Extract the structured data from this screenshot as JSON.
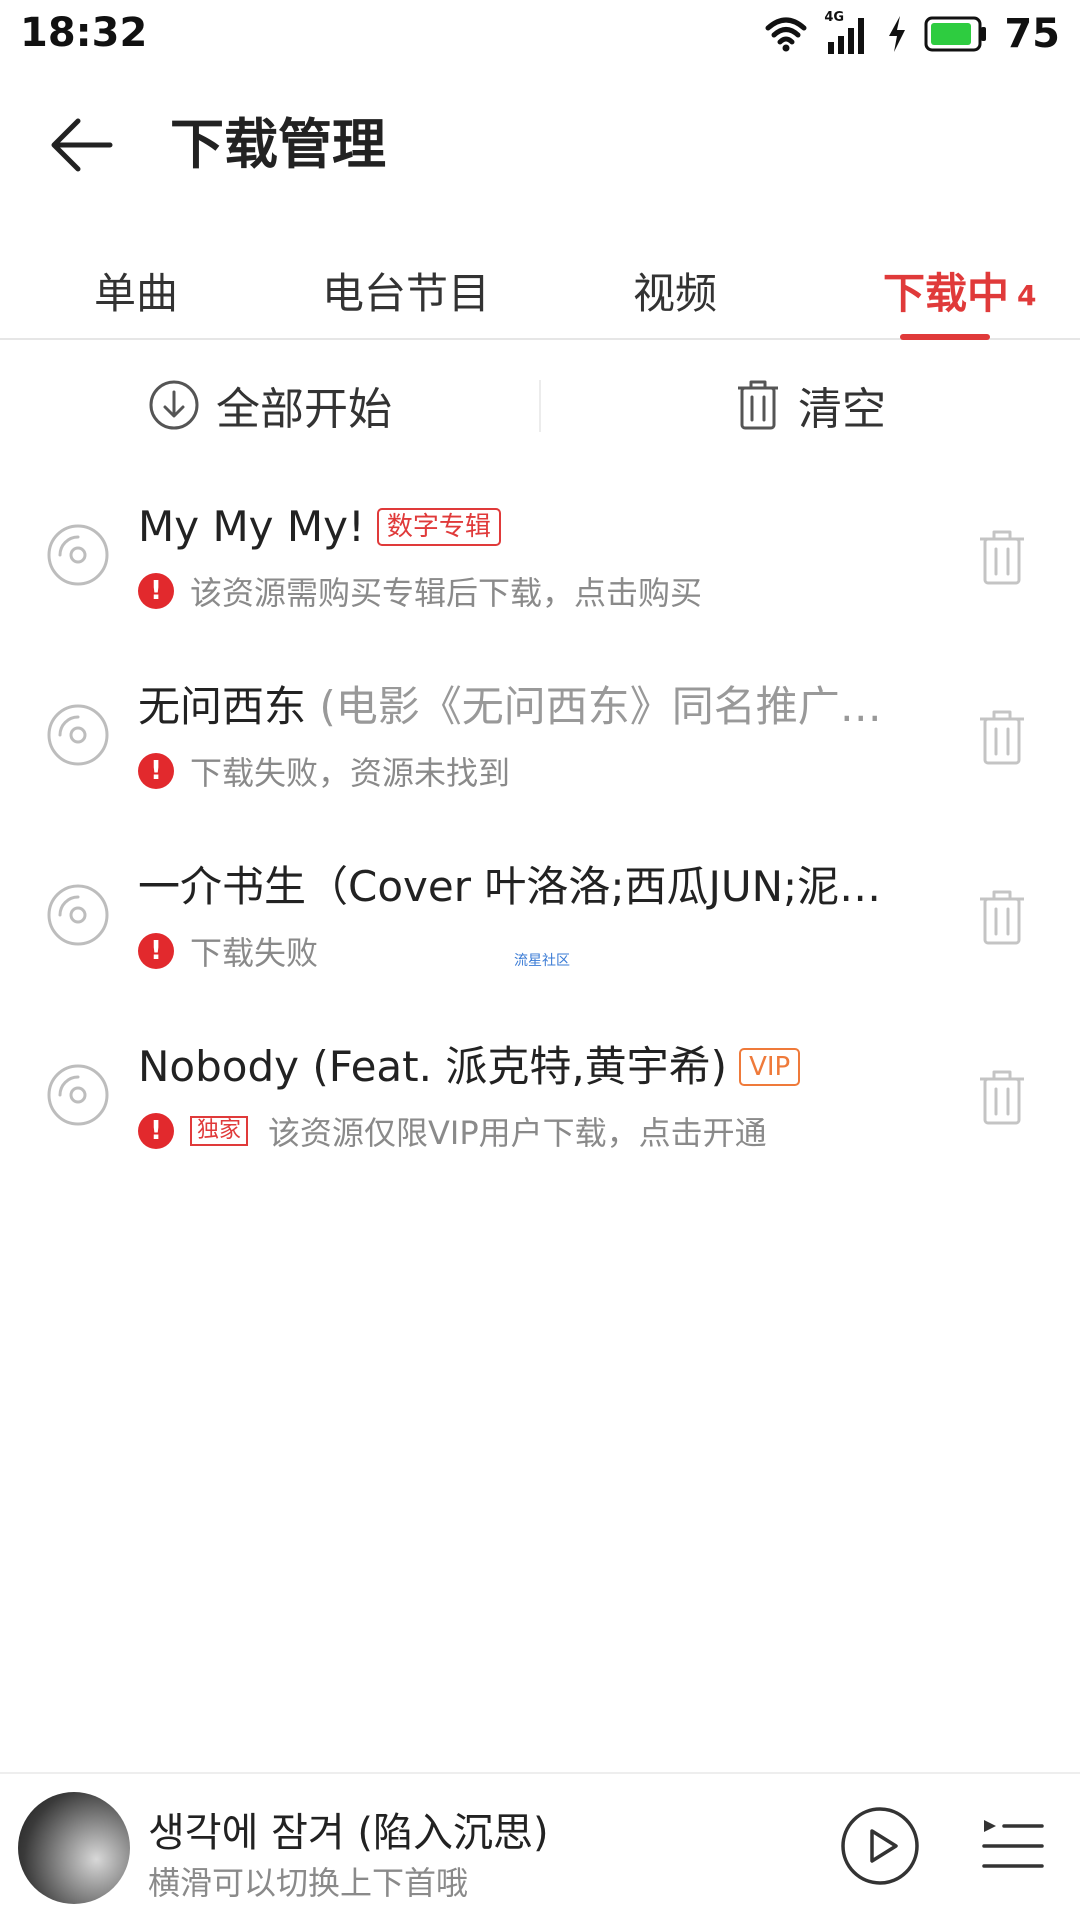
{
  "status_bar": {
    "time": "18:32",
    "network": "4G",
    "battery": "75",
    "icons": [
      "wifi-icon",
      "signal-icon",
      "charging-icon",
      "battery-icon"
    ]
  },
  "header": {
    "title": "下载管理",
    "back_icon": "arrow-left-icon"
  },
  "tabs": [
    {
      "label": "单曲",
      "active": false
    },
    {
      "label": "电台节目",
      "active": false
    },
    {
      "label": "视频",
      "active": false
    },
    {
      "label": "下载中",
      "active": true,
      "badge": "4"
    }
  ],
  "actions": {
    "start_all": "全部开始",
    "clear": "清空"
  },
  "downloads": [
    {
      "title": "My My My!",
      "subtitle": "",
      "tag": "数字专辑",
      "status": "该资源需购买专辑后下载，点击购买"
    },
    {
      "title": "无问西东",
      "subtitle": " (电影《无问西东》同名推广…",
      "tag": "",
      "status": "下载失败，资源未找到"
    },
    {
      "title": "一介书生（Cover 叶洛洛;西瓜JUN;泥…",
      "subtitle": "",
      "tag": "",
      "status": "下载失败"
    },
    {
      "title": "Nobody (Feat. 派克特,黄宇希)",
      "subtitle": "",
      "tag": "VIP",
      "exclusive_tag": "独家",
      "status": "该资源仅限VIP用户下载，点击开通"
    }
  ],
  "watermark": "流星社区",
  "player": {
    "title": "생각에 잠겨 (陷入沉思)",
    "subtitle": "横滑可以切换上下首哦"
  },
  "colors": {
    "accent": "#e03a3a",
    "warning": "#e2292d",
    "vip": "#ef7a3a",
    "secondary_text": "#8a8a8a"
  }
}
